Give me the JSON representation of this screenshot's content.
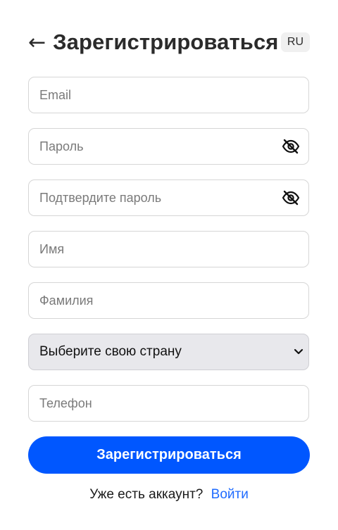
{
  "header": {
    "back_icon": "arrow-left-icon",
    "title": "Зарегистрироваться",
    "language": "RU"
  },
  "form": {
    "email": {
      "placeholder": "Email",
      "value": ""
    },
    "password": {
      "placeholder": "Пароль",
      "value": "",
      "toggle_icon": "eye-off-icon"
    },
    "confirm_password": {
      "placeholder": "Подтвердите пароль",
      "value": "",
      "toggle_icon": "eye-off-icon"
    },
    "first_name": {
      "placeholder": "Имя",
      "value": ""
    },
    "last_name": {
      "placeholder": "Фамилия",
      "value": ""
    },
    "country": {
      "selected": "Выберите свою страну",
      "icon": "chevron-down-icon"
    },
    "phone": {
      "placeholder": "Телефон",
      "value": ""
    },
    "submit_label": "Зарегистрироваться"
  },
  "footer": {
    "prompt": "Уже есть аккаунт?",
    "login_label": "Войти"
  },
  "colors": {
    "accent": "#0057ff",
    "link": "#1f6bff",
    "select_bg": "#e8e8ec"
  }
}
